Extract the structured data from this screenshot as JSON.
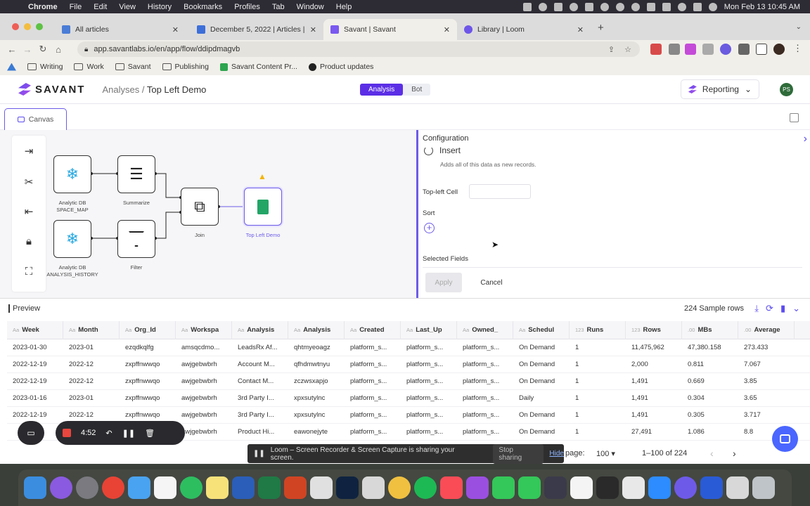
{
  "menubar": {
    "app_name": "Chrome",
    "items": [
      "File",
      "Edit",
      "View",
      "History",
      "Bookmarks",
      "Profiles",
      "Tab",
      "Window",
      "Help"
    ],
    "clock": "Mon Feb 13  10:45 AM"
  },
  "tabs": [
    {
      "title": "All articles",
      "color": "#4a7dd6",
      "active": false
    },
    {
      "title": "December 5, 2022 | Articles | S",
      "color": "#3d6fd9",
      "active": false
    },
    {
      "title": "Savant | Savant",
      "color": "#7a5af0",
      "active": true
    },
    {
      "title": "Library | Loom",
      "color": "#6d55e9",
      "active": false
    }
  ],
  "address": {
    "url": "app.savantlabs.io/en/app/flow/ddipdmagvb"
  },
  "bookmarks": [
    "Writing",
    "Work",
    "Savant",
    "Publishing",
    "Savant Content Pr...",
    "Product updates"
  ],
  "header": {
    "brand": "SAVANT",
    "breadcrumb_root": "Analyses",
    "separator": "/",
    "breadcrumb_current": "Top Left Demo",
    "mode_tabs": [
      "Analysis",
      "Bot"
    ],
    "reporting_label": "Reporting",
    "avatar_initials": "PS"
  },
  "canvas": {
    "tab_label": "Canvas"
  },
  "flow_nodes": {
    "snow1": "Analytic DB\nSPACE_MAP",
    "snow2": "Analytic DB\nANALYSIS_HISTORY",
    "summarize": "Summarize",
    "filter": "Filter",
    "join": "Join",
    "output": "Top Left Demo"
  },
  "config": {
    "title": "Configuration",
    "insert_label": "Insert",
    "insert_desc": "Adds all of this data as new records.",
    "top_left_label": "Top-left Cell",
    "sort_label": "Sort",
    "selected_fields_label": "Selected Fields",
    "apply_label": "Apply",
    "cancel_label": "Cancel"
  },
  "preview": {
    "title": "Preview",
    "sample_rows": "224 Sample rows"
  },
  "table": {
    "columns": [
      {
        "type": "Aa",
        "label": "Week"
      },
      {
        "type": "Aa",
        "label": "Month"
      },
      {
        "type": "Aa",
        "label": "Org_Id"
      },
      {
        "type": "Aa",
        "label": "Workspa"
      },
      {
        "type": "Aa",
        "label": "Analysis"
      },
      {
        "type": "Aa",
        "label": "Analysis"
      },
      {
        "type": "Aa",
        "label": "Created"
      },
      {
        "type": "Aa",
        "label": "Last_Up"
      },
      {
        "type": "Aa",
        "label": "Owned_"
      },
      {
        "type": "Aa",
        "label": "Schedul"
      },
      {
        "type": "123",
        "label": "Runs"
      },
      {
        "type": "123",
        "label": "Rows"
      },
      {
        "type": ".00",
        "label": "MBs"
      },
      {
        "type": ".00",
        "label": "Average"
      }
    ],
    "rows": [
      [
        "2023-01-30",
        "2023-01",
        "ezqdkqlfg",
        "amsqcdmo...",
        "LeadsRx Af...",
        "qhtmyeoagz",
        "platform_s...",
        "platform_s...",
        "platform_s...",
        "On Demand",
        "1",
        "11,475,962",
        "47,380.158",
        "273.433"
      ],
      [
        "2022-12-19",
        "2022-12",
        "zxpffnwwqo",
        "awjgebwbrh",
        "Account M...",
        "qfhdmwtnyu",
        "platform_s...",
        "platform_s...",
        "platform_s...",
        "On Demand",
        "1",
        "2,000",
        "0.811",
        "7.067"
      ],
      [
        "2022-12-19",
        "2022-12",
        "zxpffnwwqo",
        "awjgebwbrh",
        "Contact M...",
        "zczwsxapjo",
        "platform_s...",
        "platform_s...",
        "platform_s...",
        "On Demand",
        "1",
        "1,491",
        "0.669",
        "3.85"
      ],
      [
        "2023-01-16",
        "2023-01",
        "zxpffnwwqo",
        "awjgebwbrh",
        "3rd Party I...",
        "xpxsutylnc",
        "platform_s...",
        "platform_s...",
        "platform_s...",
        "Daily",
        "1",
        "1,491",
        "0.304",
        "3.65"
      ],
      [
        "2022-12-19",
        "2022-12",
        "zxpffnwwqo",
        "awjgebwbrh",
        "3rd Party I...",
        "xpxsutylnc",
        "platform_s...",
        "platform_s...",
        "platform_s...",
        "On Demand",
        "1",
        "1,491",
        "0.305",
        "3.717"
      ],
      [
        "",
        "",
        "",
        "awjgebwbrh",
        "Product Hi...",
        "eawonejyte",
        "platform_s...",
        "platform_s...",
        "platform_s...",
        "On Demand",
        "1",
        "27,491",
        "1.086",
        "8.8"
      ]
    ]
  },
  "pager": {
    "per_page_label": "page:",
    "per_page_value": "100",
    "range": "1–100 of 224"
  },
  "loom": {
    "timer": "4:52",
    "banner_text": "Loom – Screen Recorder & Screen Capture is sharing your screen.",
    "stop_label": "Stop sharing",
    "hide_label": "Hide"
  }
}
